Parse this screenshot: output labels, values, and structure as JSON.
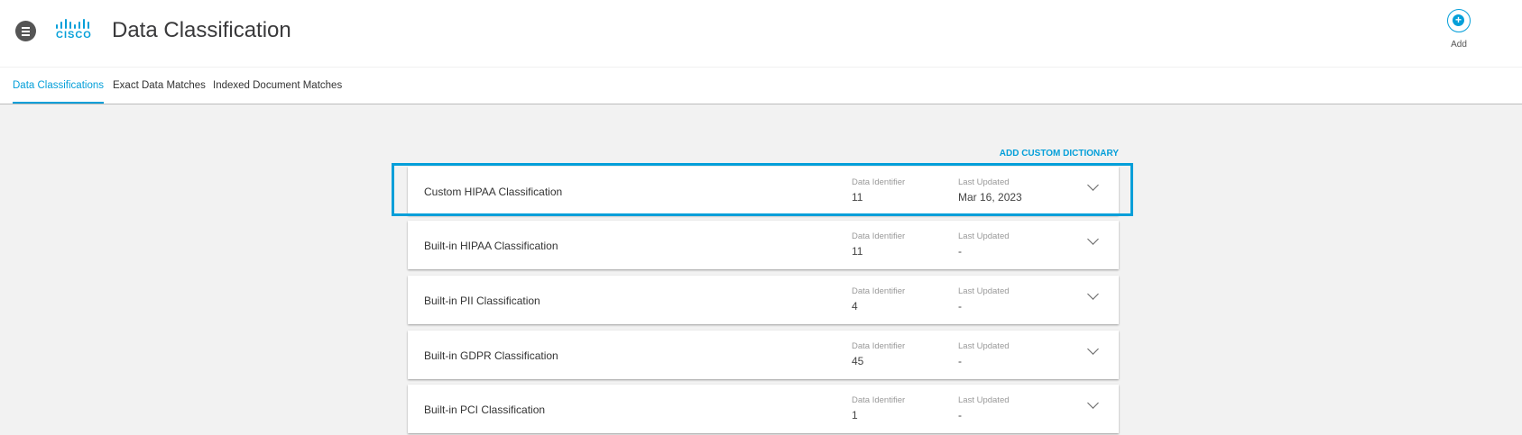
{
  "header": {
    "title": "Data Classification",
    "logo": "cisco",
    "add_label": "Add"
  },
  "tabs": [
    {
      "label": "Data Classifications",
      "active": true
    },
    {
      "label": "Exact Data Matches"
    },
    {
      "label": "Indexed Document Matches"
    }
  ],
  "add_custom_dictionary": "ADD CUSTOM DICTIONARY",
  "columns": {
    "identifier": "Data Identifier",
    "updated": "Last Updated"
  },
  "classifications": [
    {
      "name": "Custom HIPAA Classification",
      "identifiers": "11",
      "updated": "Mar 16, 2023"
    },
    {
      "name": "Built-in HIPAA Classification",
      "identifiers": "11",
      "updated": "-"
    },
    {
      "name": "Built-in PII Classification",
      "identifiers": "4",
      "updated": "-"
    },
    {
      "name": "Built-in GDPR Classification",
      "identifiers": "45",
      "updated": "-"
    },
    {
      "name": "Built-in PCI Classification",
      "identifiers": "1",
      "updated": "-"
    }
  ]
}
